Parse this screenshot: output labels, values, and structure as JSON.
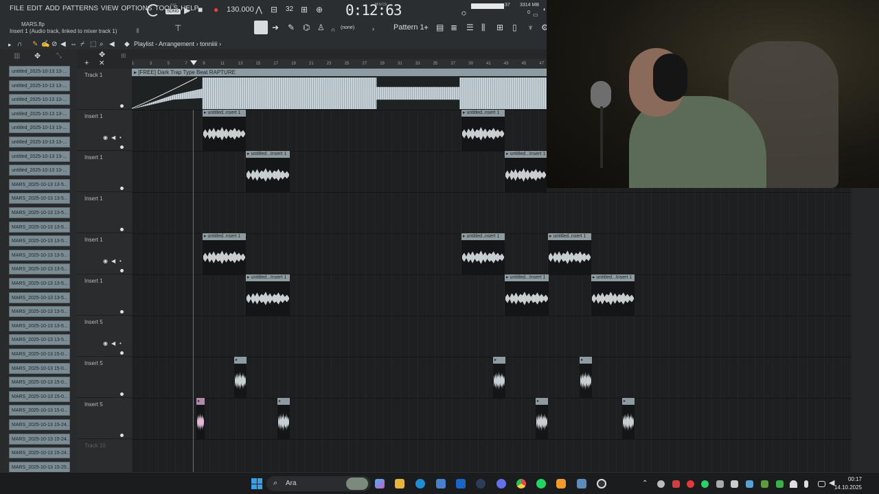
{
  "menu": [
    "FILE",
    "EDIT",
    "ADD",
    "PATTERNS",
    "VIEW",
    "OPTIONS",
    "TOOLS",
    "HELP"
  ],
  "project": {
    "file": "MARS.flp",
    "hint": "Insert 1 (Audio track, linked to mixer track 1)"
  },
  "transport": {
    "mode": "SONG",
    "pat_label": "PAT",
    "tempo": "130.000",
    "time": "0:12:63",
    "time_unit": "M:S:CS",
    "memory": "3314 MB",
    "voices": "0",
    "cpu": "37"
  },
  "toolbar": {
    "snap": "(none)",
    "pattern": "Pattern 1"
  },
  "playlist": {
    "title": "Playlist - Arrangement",
    "breadcrumb": "tonniiii",
    "ruler": [
      "1",
      "3",
      "5",
      "7",
      "9",
      "11",
      "13",
      "15",
      "17",
      "19",
      "21",
      "23",
      "25",
      "27",
      "29",
      "31",
      "33",
      "35",
      "37",
      "39",
      "41",
      "43",
      "45",
      "47"
    ]
  },
  "browser_items": [
    "untitled_2025-10-13 13-...",
    "untitled_2025-10-13 13-...",
    "untitled_2025-10-13 13-...",
    "untitled_2025-10-13 13-...",
    "untitled_2025-10-13 13-...",
    "untitled_2025-10-13 13-...",
    "untitled_2025-10-13 13-...",
    "untitled_2025-10-13 13-...",
    "MARS_2025-10-13 13-5...",
    "MARS_2025-10-13 13-5...",
    "MARS_2025-10-13 13-5...",
    "MARS_2025-10-13 13-5...",
    "MARS_2025-10-13 13-5...",
    "MARS_2025-10-13 13-5...",
    "MARS_2025-10-13 13-5...",
    "MARS_2025-10-13 13-5...",
    "MARS_2025-10-13 13-5...",
    "MARS_2025-10-13 13-5...",
    "MARS_2025-10-13 13-5...",
    "MARS_2025-10-13 13-5...",
    "MARS_2025-10-13 15-0...",
    "MARS_2025-10-13 15-0...",
    "MARS_2025-10-13 15-0...",
    "MARS_2025-10-13 15-0...",
    "MARS_2025-10-13 15-0...",
    "MARS_2025-10-13 15-24...",
    "MARS_2025-10-13 15-24...",
    "MARS_2025-10-13 15-24...",
    "MARS_2025-10-13 15-25..."
  ],
  "tracks": [
    "Track 1",
    "Insert 1",
    "Insert 1",
    "Insert 1",
    "Insert 1",
    "Insert 1",
    "Insert 5",
    "Insert 5",
    "Insert 5",
    "Track 10"
  ],
  "big_clip_label": "[FREE] Dark Trap Type Beat RAPTURE",
  "clip_labels": {
    "a": "untitled..nsert 1",
    "b": "untitled...Insert 1",
    "c": "untitled...Insert 1",
    "d": "untitled...Insert 1"
  },
  "taskbar": {
    "search": "Ara",
    "time": "00:17",
    "date": "14.10.2025"
  },
  "colors": {
    "clip_header": "#8e9ba1",
    "waveform": "#d6dbde",
    "background": "#1d1f20"
  }
}
